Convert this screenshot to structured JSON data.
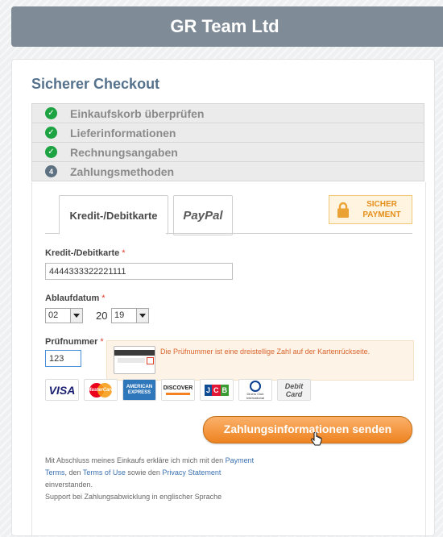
{
  "header": {
    "title": "GR Team Ltd"
  },
  "checkout": {
    "title": "Sicherer Checkout",
    "steps": [
      {
        "label": "Einkaufskorb überprüfen",
        "status": "done",
        "icon": "check-icon"
      },
      {
        "label": "Lieferinformationen",
        "status": "done",
        "icon": "check-icon"
      },
      {
        "label": "Rechnungsangaben",
        "status": "done",
        "icon": "check-icon"
      },
      {
        "label": "Zahlungsmethoden",
        "status": "current",
        "number": "4"
      }
    ]
  },
  "tabs": {
    "card": "Kredit-/Debitkarte",
    "paypal": "PayPal"
  },
  "secure_badge": {
    "line1": "SICHER",
    "line2": "PAYMENT"
  },
  "form": {
    "card_label": "Kredit-/Debitkarte",
    "card_number": "4444333322221111",
    "expiry_label": "Ablaufdatum",
    "expiry_month": "02",
    "expiry_century": "20",
    "expiry_year": "19",
    "cvc_label": "Prüfnummer",
    "cvc_value": "123",
    "required_mark": "*",
    "cvc_hint": "Die Prüfnummer ist eine dreistellige Zahl auf der Kartenrückseite."
  },
  "card_logos": [
    "VISA",
    "MasterCard",
    "AMERICAN EXPRESS",
    "DISCOVER",
    "JCB",
    "Diners Club International",
    "Debit Card"
  ],
  "submit_label": "Zahlungsinformationen senden",
  "legal": {
    "text1": "Mit Abschluss meines Einkaufs erkläre ich mich mit den ",
    "link_terms": "Payment Terms",
    "text2": ", den ",
    "link_use": "Terms of Use",
    "text3": " sowie den ",
    "link_privacy": "Privacy Statement",
    "text4": " einverstanden.",
    "support": "Support bei Zahlungsabwicklung in englischer Sprache"
  },
  "colors": {
    "accent_orange": "#ee8320",
    "header_bg": "#7f8b96",
    "title_blue": "#55728d",
    "done_green": "#1ea342"
  }
}
